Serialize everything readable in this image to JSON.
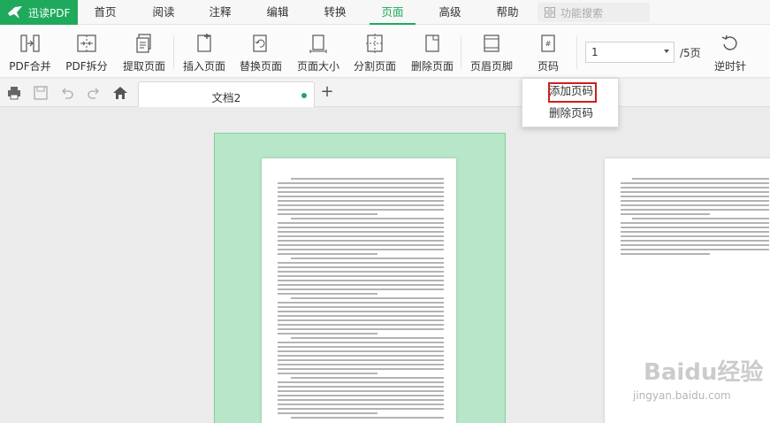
{
  "brand": {
    "name": "迅读PDF"
  },
  "menu": {
    "items": [
      {
        "label": "首页"
      },
      {
        "label": "阅读"
      },
      {
        "label": "注释"
      },
      {
        "label": "编辑"
      },
      {
        "label": "转换"
      },
      {
        "label": "页面"
      },
      {
        "label": "高级"
      },
      {
        "label": "帮助"
      }
    ],
    "active": "页面",
    "search_placeholder": "功能搜索"
  },
  "ribbon": {
    "tools": [
      {
        "label": "PDF合并",
        "icon": "merge-icon"
      },
      {
        "label": "PDF拆分",
        "icon": "split-icon"
      },
      {
        "label": "提取页面",
        "icon": "extract-page-icon"
      },
      {
        "label": "插入页面",
        "icon": "insert-page-icon"
      },
      {
        "label": "替换页面",
        "icon": "replace-page-icon"
      },
      {
        "label": "页面大小",
        "icon": "page-size-icon"
      },
      {
        "label": "分割页面",
        "icon": "divide-page-icon"
      },
      {
        "label": "删除页面",
        "icon": "delete-page-icon"
      },
      {
        "label": "页眉页脚",
        "icon": "header-footer-icon"
      },
      {
        "label": "页码",
        "icon": "page-number-icon"
      }
    ],
    "page_input": "1",
    "page_total": "/5页",
    "rotate_label": "逆时针"
  },
  "quickbar": {
    "icons": [
      "print-icon",
      "save-icon",
      "undo-icon",
      "redo-icon",
      "home-icon"
    ]
  },
  "tab": {
    "title": "文档2",
    "new_tab": "+"
  },
  "dropdown": {
    "items": [
      {
        "label": "添加页码",
        "highlighted": true
      },
      {
        "label": "删除页码",
        "highlighted": false
      }
    ]
  },
  "watermark": {
    "title": "Baidu经验",
    "url": "jingyan.baidu.com"
  },
  "colors": {
    "accent": "#1fa95c",
    "highlight_box": "#d21c1c",
    "thumb_selected": "#b8e6c8"
  }
}
